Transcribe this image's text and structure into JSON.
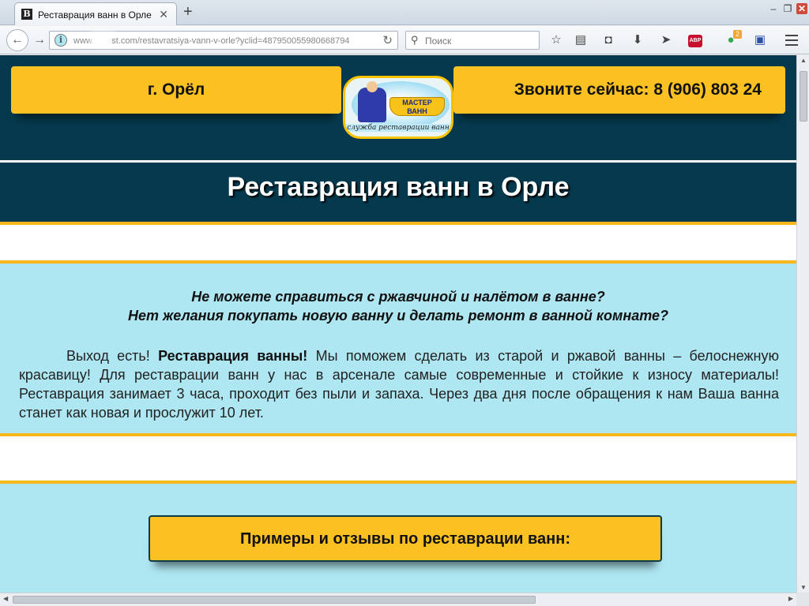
{
  "browser": {
    "tab_title": "Реставрация ванн в Орле",
    "favicon": "B",
    "url_prefix": "www.",
    "url_host_end": "st.com",
    "url_path": "/restavratsiya-vann-v-orle?yclid=487950055980668794",
    "search_placeholder": "Поиск",
    "extension_badge": "2",
    "abp_label": "ABP"
  },
  "site": {
    "city": "г. Орёл",
    "phone": "Звоните сейчас: 8 (906) 803 24",
    "logo": {
      "line1": "МАСТЕР",
      "line2": "ВАНН",
      "subtitle": "служба реставрации ванн"
    },
    "title": "Реставрация ванн в Орле",
    "question1": "Не можете справиться с ржавчиной и налётом в ванне?",
    "question2": "Нет желания покупать новую ванну и делать ремонт в ванной комнате?",
    "para_start": "Выход есть! ",
    "para_bold": "Реставрация ванны!",
    "para_rest": " Мы поможем сделать из старой и ржавой ванны – белоснежную красавицу! Для реставрации ванн у нас в арсенале самые современные и стойкие к износу материалы! Реставрация занимает 3 часа, проходит без пыли и запаха. Через два дня после обращения к нам Ваша ванна станет как новая и прослужит 10 лет.",
    "examples_button": "Примеры и отзывы по реставрации ванн:"
  },
  "colors": {
    "header_bg": "#053a4e",
    "accent_yellow": "#fbc022",
    "light_blue": "#aee7f2"
  }
}
